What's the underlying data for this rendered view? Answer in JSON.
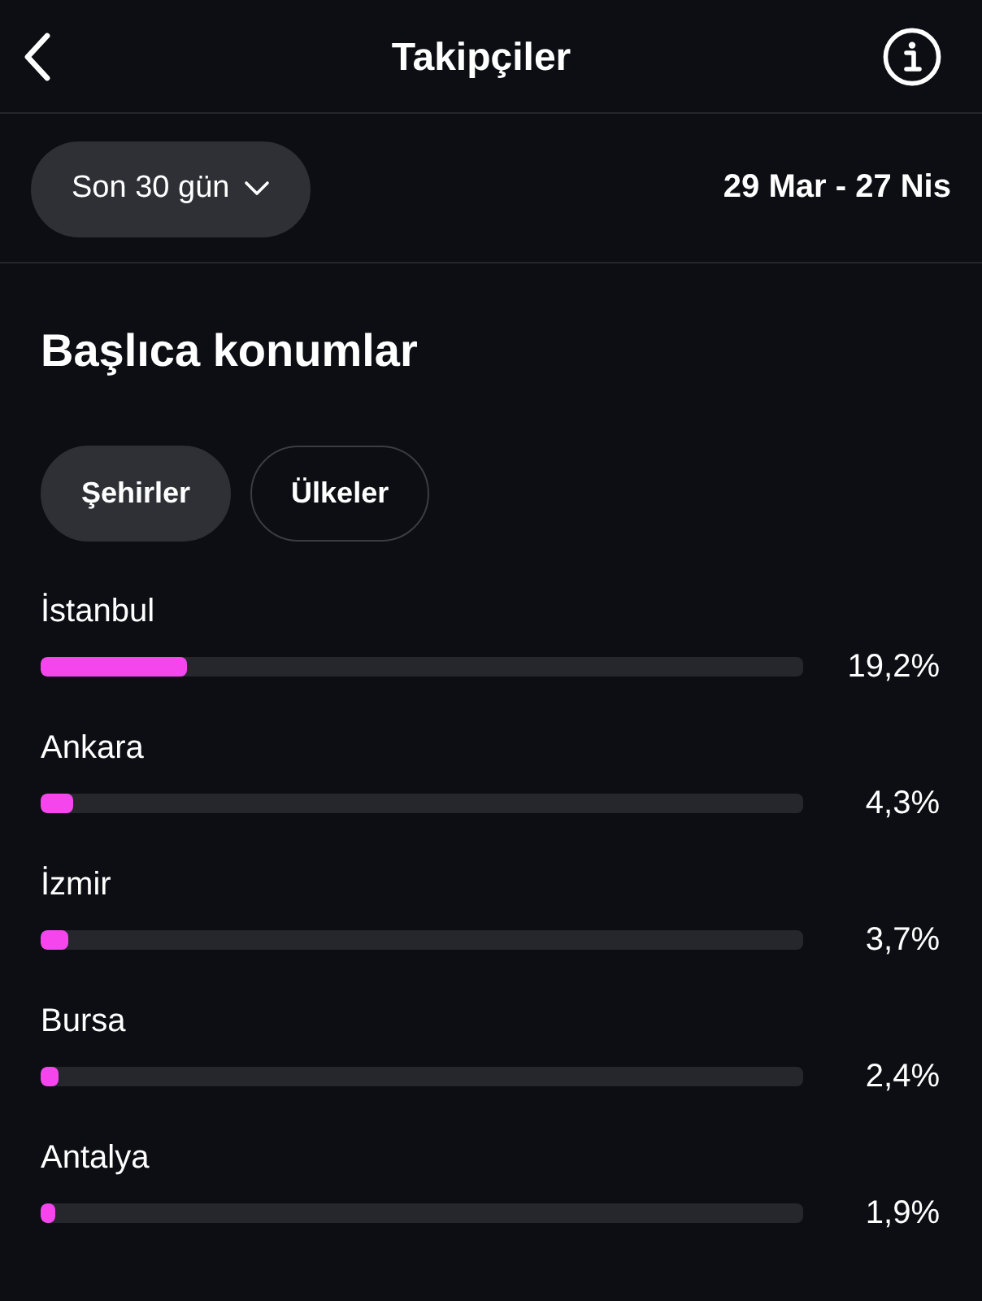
{
  "header": {
    "title": "Takipçiler"
  },
  "filter": {
    "period": "Son 30 gün",
    "date_range": "29 Mar - 27 Nis"
  },
  "locations": {
    "title": "Başlıca konumlar",
    "tabs": [
      {
        "label": "Şehirler",
        "selected": true
      },
      {
        "label": "Ülkeler",
        "selected": false
      }
    ],
    "items": [
      {
        "name": "İstanbul",
        "level": 0.192,
        "reading": "19,2%"
      },
      {
        "name": "Ankara",
        "level": 0.043,
        "reading": "4,3%"
      },
      {
        "name": "İzmir",
        "level": 0.037,
        "reading": "3,7%"
      },
      {
        "name": "Bursa",
        "level": 0.024,
        "reading": "2,4%"
      },
      {
        "name": "Antalya",
        "level": 0.019,
        "reading": "1,9%"
      }
    ]
  }
}
